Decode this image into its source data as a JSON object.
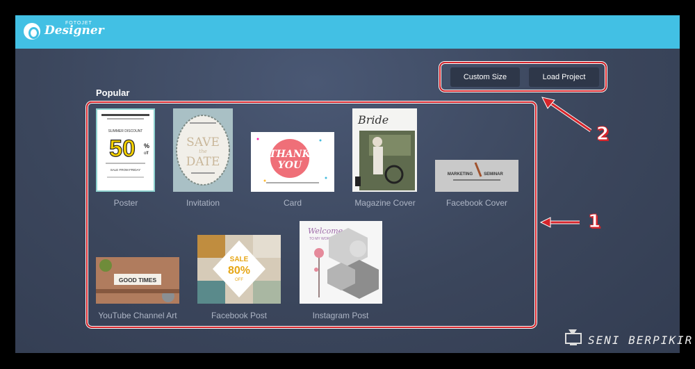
{
  "app": {
    "logo_main": "Designer",
    "logo_small": "FOTOJET"
  },
  "toolbar": {
    "custom_size_label": "Custom Size",
    "load_project_label": "Load Project"
  },
  "section": {
    "title": "Popular"
  },
  "templates": [
    {
      "label": "Poster",
      "art": {
        "top1": "SUMMER DISCOUNT",
        "big": "50",
        "pct": "%",
        "off": "off",
        "sale": "SALE FROM FRIDAY"
      }
    },
    {
      "label": "Invitation",
      "art": {
        "line1": "SAVE",
        "line2": "the",
        "line3": "DATE"
      }
    },
    {
      "label": "Card",
      "art": {
        "line1": "THANK",
        "line2": "YOU"
      }
    },
    {
      "label": "Magazine Cover",
      "art": {
        "title": "Bride"
      }
    },
    {
      "label": "Facebook Cover",
      "art": {
        "left": "MARKETING",
        "right": "SEMINAR"
      }
    },
    {
      "label": "YouTube Channel Art",
      "art": {
        "text": "GOOD TIMES"
      }
    },
    {
      "label": "Facebook Post",
      "art": {
        "sale": "SALE",
        "pct": "80%",
        "off": "OFF"
      }
    },
    {
      "label": "Instagram Post",
      "art": {
        "line1": "Welcome",
        "line2": "TO MY WORLD"
      }
    }
  ],
  "annotations": {
    "n1": "1",
    "n2": "2"
  },
  "watermark": "SENI BERPIKIR",
  "colors": {
    "topbar": "#42c0e4",
    "highlight": "#d6252b",
    "panel": "#3b465c"
  }
}
